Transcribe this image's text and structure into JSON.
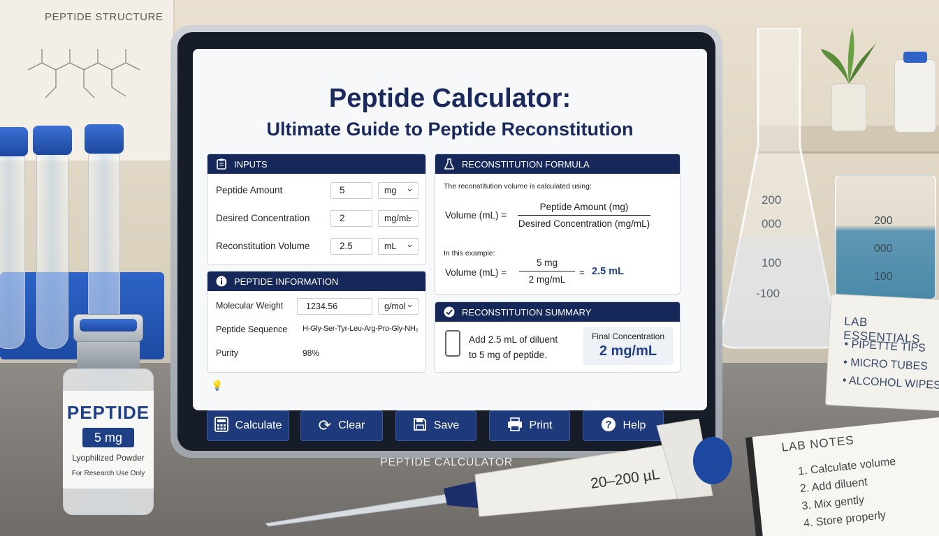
{
  "background": {
    "structure_board_title": "PEPTIDE STRUCTURE",
    "lab_essentials": {
      "title": "LAB ESSENTIALS",
      "items": [
        "• PIPETTE TIPS",
        "• MICRO TUBES",
        "• ALCOHOL WIPES"
      ]
    },
    "lab_notes": {
      "title": "LAB NOTES",
      "items": [
        "1. Calculate volume",
        "2. Add diluent",
        "3. Mix gently",
        "4. Store properly"
      ]
    },
    "vial": {
      "name": "PEPTIDE",
      "amount": "5 mg",
      "form": "Lyophilized Powder",
      "note": "For Research Use Only"
    },
    "pipette_range": "20–200 µL",
    "beaker_marks": [
      "200",
      "000",
      "100"
    ],
    "flask_marks": [
      "200",
      "000",
      "100",
      "-100"
    ]
  },
  "app": {
    "title": "Peptide Calculator:",
    "subtitle": "Ultimate Guide to Peptide Reconstitution",
    "device_label": "PEPTIDE CALCULATOR",
    "colors": {
      "header": "#16285a",
      "accent": "#1f3f87"
    }
  },
  "inputs": {
    "header": "INPUTS",
    "icon": "clipboard-icon",
    "rows": [
      {
        "label": "Peptide Amount",
        "value": "5",
        "unit": "mg"
      },
      {
        "label": "Desired Concentration",
        "value": "2",
        "unit": "mg/mL"
      },
      {
        "label": "Reconstitution Volume",
        "value": "2.5",
        "unit": "mL"
      }
    ]
  },
  "peptide_info": {
    "header": "PEPTIDE INFORMATION",
    "icon": "info-icon",
    "molecular_weight_label": "Molecular Weight",
    "molecular_weight_value": "1234.56",
    "molecular_weight_unit": "g/mol",
    "sequence_label": "Peptide Sequence",
    "sequence_value": "H-Gly-Ser-Tyr-Leu-Arg-Pro-Gly-NH₂",
    "purity_label": "Purity",
    "purity_value": "98%"
  },
  "formula": {
    "header": "RECONSTITUTION FORMULA",
    "icon": "flask-icon",
    "intro": "The reconstitution volume is calculated using:",
    "lhs": "Volume (mL) =",
    "numerator": "Peptide Amount (mg)",
    "denominator": "Desired Concentration (mg/mL)",
    "example_label": "In this example:",
    "ex_lhs": "Volume (mL) =",
    "ex_num": "5 mg",
    "ex_den": "2 mg/mL",
    "ex_eq": "=",
    "ex_result": "2.5 mL"
  },
  "summary": {
    "header": "RECONSTITUTION SUMMARY",
    "icon": "check-circle-icon",
    "line1": "Add 2.5 mL of diluent",
    "line2": "to 5 mg of peptide.",
    "final_label": "Final Concentration",
    "final_value": "2 mg/mL"
  },
  "toolbar": {
    "buttons": [
      {
        "label": "Calculate",
        "icon": "calculator-icon"
      },
      {
        "label": "Clear",
        "icon": "refresh-icon"
      },
      {
        "label": "Save",
        "icon": "save-icon"
      },
      {
        "label": "Print",
        "icon": "printer-icon"
      },
      {
        "label": "Help",
        "icon": "help-icon"
      }
    ]
  }
}
